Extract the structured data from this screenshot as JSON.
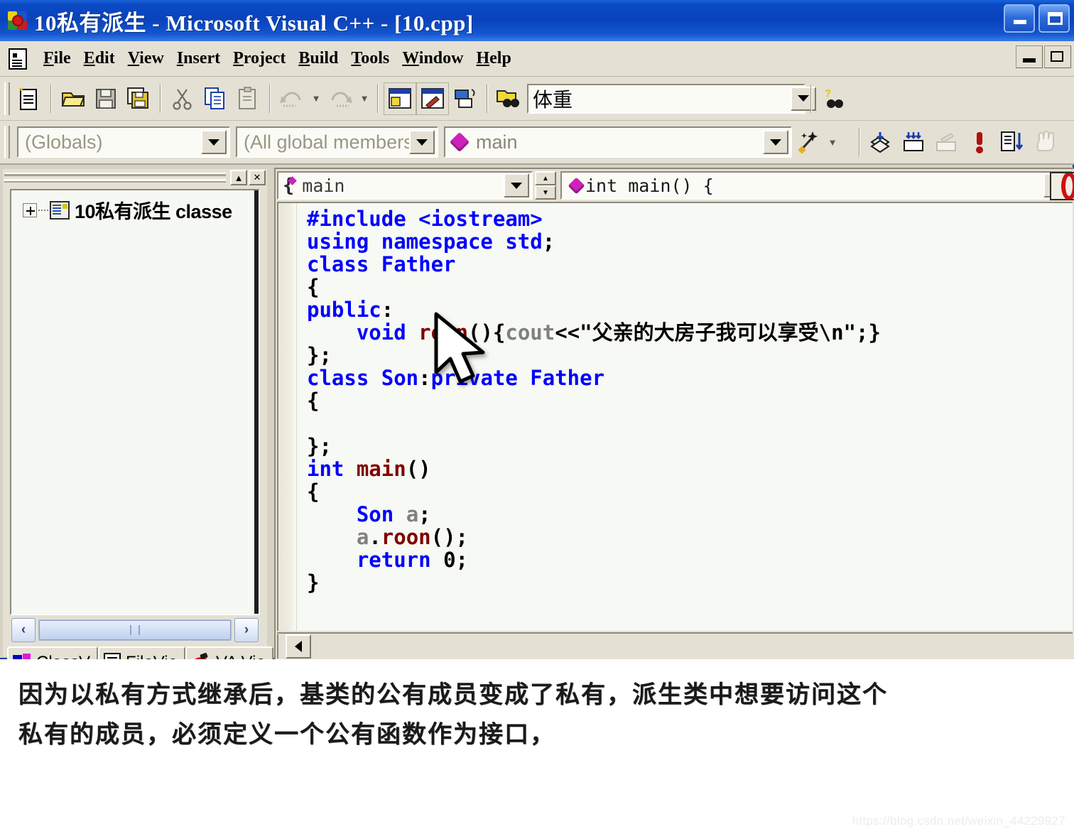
{
  "window": {
    "title": "10私有派生 - Microsoft Visual C++ - [10.cpp]",
    "app_icon": "vcpp-icon",
    "minimize_label": "Minimize",
    "maximize_label": "Maximize"
  },
  "menu": {
    "items": [
      {
        "mnemonic": "F",
        "rest": "ile"
      },
      {
        "mnemonic": "E",
        "rest": "dit"
      },
      {
        "mnemonic": "V",
        "rest": "iew"
      },
      {
        "mnemonic": "I",
        "rest": "nsert"
      },
      {
        "mnemonic": "P",
        "rest": "roject"
      },
      {
        "mnemonic": "B",
        "rest": "uild"
      },
      {
        "mnemonic": "T",
        "rest": "ools"
      },
      {
        "mnemonic": "W",
        "rest": "indow"
      },
      {
        "mnemonic": "H",
        "rest": "elp"
      }
    ]
  },
  "toolbar_standard": {
    "icons": [
      "new-document-icon",
      "open-folder-icon",
      "save-icon",
      "save-all-icon",
      "cut-icon",
      "copy-icon",
      "paste-icon",
      "undo-icon",
      "redo-icon",
      "workspace-window-icon",
      "output-window-icon",
      "watch-window-icon",
      "find-in-files-icon"
    ],
    "find_value": "体重",
    "find_placeholder": "",
    "help_search_icon": "help-binoculars-icon"
  },
  "toolbar_wizard": {
    "globals_value": "(Globals)",
    "members_value": "(All global members",
    "symbol_value": "main",
    "magic_icon": "wizard-wand-icon",
    "va_icons": [
      "va-open-file-icon",
      "va-open-corresponding-icon",
      "va-refactor-icon",
      "va-error-icon",
      "va-outline-icon",
      "va-hand-icon"
    ]
  },
  "workspace": {
    "caption_buttons": [
      "collapse-button",
      "close-button"
    ],
    "tree": {
      "expander": "+",
      "icon": "class-folder-icon",
      "label": "10私有派生 classe"
    },
    "hscroll": {
      "left_label": "‹",
      "right_label": "›"
    },
    "tabs": [
      {
        "label": "ClassV",
        "icon": "classview-icon",
        "active": false
      },
      {
        "label": "FileVie",
        "icon": "fileview-icon",
        "active": true
      },
      {
        "label": "VA Vie",
        "icon": "vaview-apple-icon",
        "active": false
      }
    ]
  },
  "editor": {
    "function_combo_value": "main",
    "prototype_value": "int main() {",
    "brace_icon": "function-brace-icon",
    "spin_up": "▲",
    "spin_down": "▼",
    "hscroll_left": "scroll-left-arrow",
    "code_lines": [
      [
        {
          "t": "#include <iostream>",
          "c": "kw"
        }
      ],
      [
        {
          "t": "using namespace std",
          "c": "kw"
        },
        {
          "t": ";",
          "c": "pl"
        }
      ],
      [
        {
          "t": "class Father",
          "c": "kw"
        }
      ],
      [
        {
          "t": "{",
          "c": "pl"
        }
      ],
      [
        {
          "t": "public",
          "c": "kw"
        },
        {
          "t": ":",
          "c": "pl"
        }
      ],
      [
        {
          "t": "    ",
          "c": "pl"
        },
        {
          "t": "void ",
          "c": "kw"
        },
        {
          "t": "roon",
          "c": "fn"
        },
        {
          "t": "(){",
          "c": "pl"
        },
        {
          "t": "cout",
          "c": "id"
        },
        {
          "t": "<<\"父亲的大房子我可以享受\\n\";}",
          "c": "pl"
        }
      ],
      [
        {
          "t": "};",
          "c": "pl"
        }
      ],
      [
        {
          "t": "class Son",
          "c": "kw"
        },
        {
          "t": ":",
          "c": "pl"
        },
        {
          "t": "private Father",
          "c": "kw"
        }
      ],
      [
        {
          "t": "{",
          "c": "pl"
        }
      ],
      [
        {
          "t": "",
          "c": "pl"
        }
      ],
      [
        {
          "t": "};",
          "c": "pl"
        }
      ],
      [
        {
          "t": "int ",
          "c": "kw"
        },
        {
          "t": "main",
          "c": "fn"
        },
        {
          "t": "()",
          "c": "pl"
        }
      ],
      [
        {
          "t": "{",
          "c": "pl"
        }
      ],
      [
        {
          "t": "    ",
          "c": "pl"
        },
        {
          "t": "Son ",
          "c": "kw"
        },
        {
          "t": "a",
          "c": "id"
        },
        {
          "t": ";",
          "c": "pl"
        }
      ],
      [
        {
          "t": "    ",
          "c": "pl"
        },
        {
          "t": "a",
          "c": "id"
        },
        {
          "t": ".",
          "c": "pl"
        },
        {
          "t": "roon",
          "c": "fn"
        },
        {
          "t": "();",
          "c": "pl"
        }
      ],
      [
        {
          "t": "    ",
          "c": "pl"
        },
        {
          "t": "return ",
          "c": "kw"
        },
        {
          "t": "0",
          "c": "pl"
        },
        {
          "t": ";",
          "c": "pl"
        }
      ],
      [
        {
          "t": "}",
          "c": "pl"
        }
      ]
    ]
  },
  "annotation": {
    "line1": "因为以私有方式继承后，基类的公有成员变成了私有，派生类中想要访问这个",
    "line2": "私有的成员，必须定义一个公有函数作为接口，"
  },
  "watermark": "https://blog.csdn.net/weixin_44229927",
  "colors": {
    "title_bar": "#0a43bb",
    "chrome": "#e4e1d4",
    "keyword": "#0000ff",
    "function": "#800000",
    "identifier": "#808080",
    "editor_bg": "#f7f9f4"
  }
}
